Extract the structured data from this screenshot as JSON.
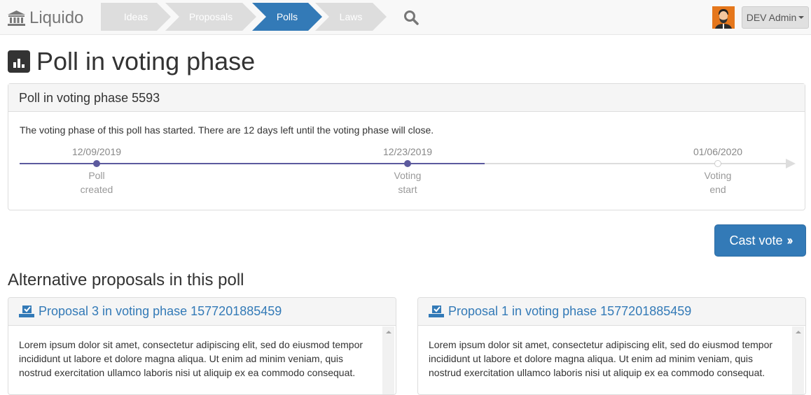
{
  "navbar": {
    "brand": "Liquido",
    "steps": [
      "Ideas",
      "Proposals",
      "Polls",
      "Laws"
    ],
    "active_step": "Polls",
    "user_label": "DEV Admin"
  },
  "page": {
    "title": "Poll in voting phase"
  },
  "poll": {
    "heading": "Poll in voting phase 5593",
    "status_text": "The voting phase of this poll has started. There are 12 days left until the voting phase will close.",
    "timeline": [
      {
        "date": "12/09/2019",
        "label_line1": "Poll",
        "label_line2": "created"
      },
      {
        "date": "12/23/2019",
        "label_line1": "Voting",
        "label_line2": "start"
      },
      {
        "date": "01/06/2020",
        "label_line1": "Voting",
        "label_line2": "end"
      }
    ],
    "timeline_progress": 0.6
  },
  "cast_vote_label": "Cast vote",
  "alternatives": {
    "title": "Alternative proposals in this poll",
    "proposals": [
      {
        "title": "Proposal 3 in voting phase 1577201885459",
        "body": "Lorem ipsum dolor sit amet, consectetur adipiscing elit, sed do eiusmod tempor incididunt ut labore et dolore magna aliqua. Ut enim ad minim veniam, quis nostrud exercitation ullamco laboris nisi ut aliquip ex ea commodo consequat."
      },
      {
        "title": "Proposal 1 in voting phase 1577201885459",
        "body": "Lorem ipsum dolor sit amet, consectetur adipiscing elit, sed do eiusmod tempor incididunt ut labore et dolore magna aliqua. Ut enim ad minim veniam, quis nostrud exercitation ullamco laboris nisi ut aliquip ex ea commodo consequat."
      }
    ]
  },
  "colors": {
    "primary": "#337ab7",
    "timeline": "#5c5a9e",
    "avatar_bg": "#e5771c"
  },
  "icons": {
    "brand": "bank-icon",
    "search": "search-icon",
    "title": "bar-chart-icon",
    "proposal": "ballot-check-icon",
    "cast": "double-chevron-right-icon"
  }
}
